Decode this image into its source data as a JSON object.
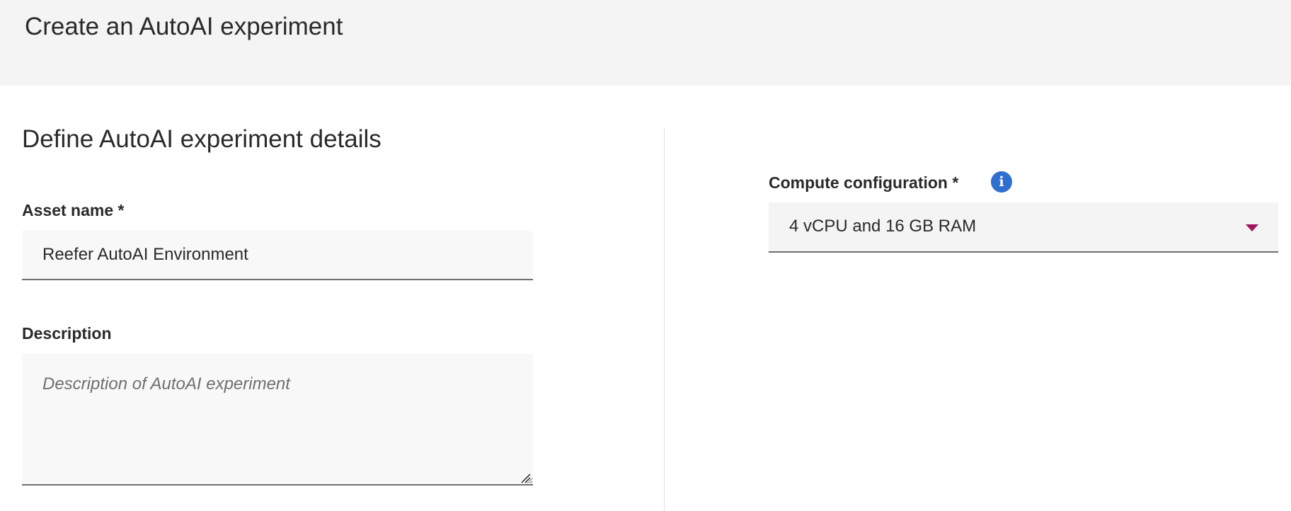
{
  "header": {
    "title": "Create an AutoAI experiment"
  },
  "details": {
    "section_title": "Define AutoAI experiment details",
    "asset_name": {
      "label": "Asset name *",
      "value": "Reefer AutoAI Environment"
    },
    "description": {
      "label": "Description",
      "value": "",
      "placeholder": "Description of AutoAI experiment"
    }
  },
  "compute": {
    "label": "Compute configuration *",
    "info_icon": "info-icon",
    "selected": "4 vCPU and 16 GB RAM",
    "dropdown_icon": "chevron-down-icon"
  },
  "colors": {
    "header_bg": "#f4f4f4",
    "input_bg": "#f8f8f8",
    "info_blue": "#2f6fd0",
    "dropdown_arrow": "#a0145f"
  }
}
